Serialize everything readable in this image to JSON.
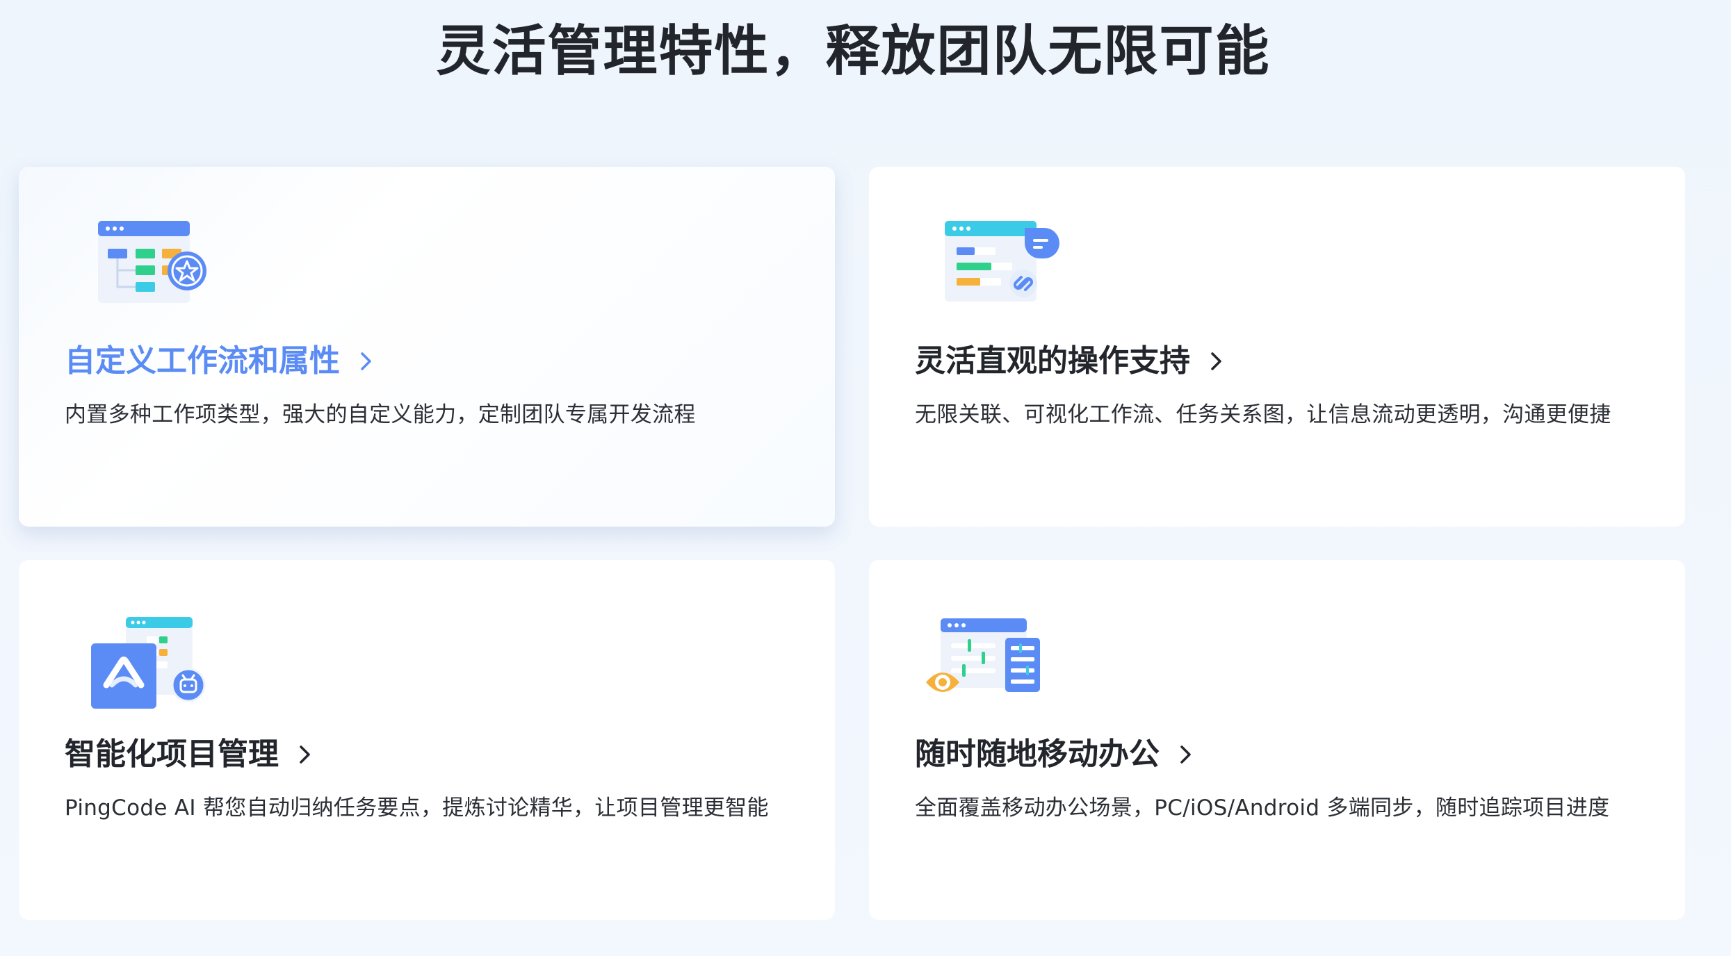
{
  "page": {
    "title": "灵活管理特性，释放团队无限可能"
  },
  "colors": {
    "accent": "#5b8cf5",
    "green": "#2fcf8c",
    "orange": "#f6b13c",
    "cyan": "#3ccbe6",
    "text": "#22252b"
  },
  "cards": [
    {
      "title": "自定义工作流和属性",
      "description": "内置多种工作项类型，强大的自定义能力，定制团队专属开发流程",
      "icon": "workflow-star-icon",
      "active": true
    },
    {
      "title": "灵活直观的操作支持",
      "description": "无限关联、可视化工作流、任务关系图，让信息流动更透明，沟通更便捷",
      "icon": "link-chat-icon",
      "active": false
    },
    {
      "title": "智能化项目管理",
      "description": "PingCode AI 帮您自动归纳任务要点，提炼讨论精华，让项目管理更智能",
      "icon": "ai-robot-icon",
      "active": false
    },
    {
      "title": "随时随地移动办公",
      "description": "全面覆盖移动办公场景，PC/iOS/Android 多端同步，随时追踪项目进度",
      "icon": "mobile-eye-icon",
      "active": false
    }
  ]
}
